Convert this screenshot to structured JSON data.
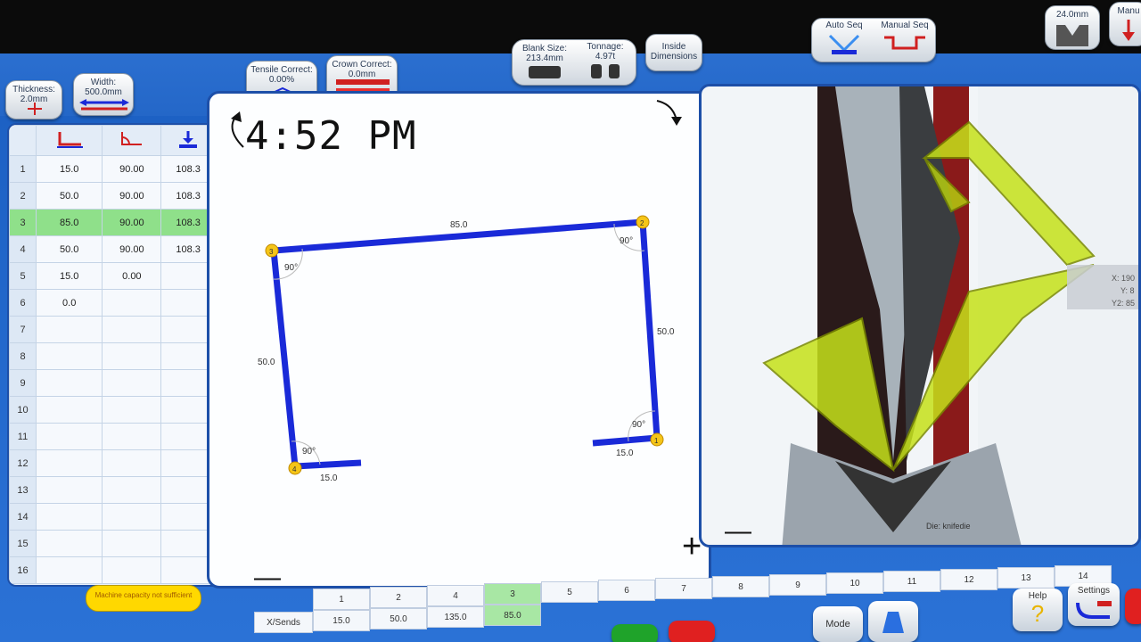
{
  "toolbar": {
    "thickness": {
      "label": "Thickness:",
      "value": "2.0mm"
    },
    "width": {
      "label": "Width:",
      "value": "500.0mm"
    },
    "tensile": {
      "label": "Tensile Correct:",
      "value": "0.00%"
    },
    "crown": {
      "label": "Crown Correct:",
      "value": "0.0mm"
    },
    "blank_size": {
      "label": "Blank Size:",
      "value": "213.4mm"
    },
    "tonnage": {
      "label": "Tonnage:",
      "value": "4.97t"
    },
    "inside_dimensions": {
      "label": "Inside Dimensions"
    },
    "auto_seq": {
      "label": "Auto Seq"
    },
    "manual_seq": {
      "label": "Manual Seq"
    },
    "tool_value": "24.0mm",
    "manual_label": "Manu"
  },
  "bend_table": {
    "rows": [
      {
        "num": "1",
        "length": "15.0",
        "angle": "90.00",
        "pos": "108.3",
        "more": "..."
      },
      {
        "num": "2",
        "length": "50.0",
        "angle": "90.00",
        "pos": "108.3",
        "more": "..."
      },
      {
        "num": "3",
        "length": "85.0",
        "angle": "90.00",
        "pos": "108.3",
        "more": "..."
      },
      {
        "num": "4",
        "length": "50.0",
        "angle": "90.00",
        "pos": "108.3",
        "more": "..."
      },
      {
        "num": "5",
        "length": "15.0",
        "angle": "0.00",
        "pos": "",
        "more": ""
      },
      {
        "num": "6",
        "length": "0.0",
        "angle": "",
        "pos": "",
        "more": ""
      },
      {
        "num": "7",
        "length": "",
        "angle": "",
        "pos": "",
        "more": ""
      },
      {
        "num": "8",
        "length": "",
        "angle": "",
        "pos": "",
        "more": ""
      },
      {
        "num": "9",
        "length": "",
        "angle": "",
        "pos": "",
        "more": ""
      },
      {
        "num": "10",
        "length": "",
        "angle": "",
        "pos": "",
        "more": ""
      },
      {
        "num": "11",
        "length": "",
        "angle": "",
        "pos": "",
        "more": ""
      },
      {
        "num": "12",
        "length": "",
        "angle": "",
        "pos": "",
        "more": ""
      },
      {
        "num": "13",
        "length": "",
        "angle": "",
        "pos": "",
        "more": ""
      },
      {
        "num": "14",
        "length": "",
        "angle": "",
        "pos": "",
        "more": ""
      },
      {
        "num": "15",
        "length": "",
        "angle": "",
        "pos": "",
        "more": ""
      },
      {
        "num": "16",
        "length": "",
        "angle": "",
        "pos": "",
        "more": ""
      }
    ],
    "selected_row": "3"
  },
  "drawing": {
    "time": "4:52 PM",
    "dim_top": "85.0",
    "dim_left": "50.0",
    "dim_right": "50.0",
    "dim_bottom_left": "15.0",
    "dim_bottom_right": "15.0",
    "angle_label": "90°",
    "node_labels": [
      "1",
      "2",
      "3",
      "4"
    ],
    "zoom_in": "+",
    "zoom_out": "—"
  },
  "view3d": {
    "die_label": "Die: knifedie",
    "coords": [
      "X: 190",
      "Y: 8",
      "Y2: 85"
    ],
    "zoom_out": "—"
  },
  "sequence": {
    "bend_numbers": [
      "1",
      "2",
      "4",
      "3",
      "5",
      "6",
      "7",
      "8",
      "9",
      "10",
      "11",
      "12",
      "13",
      "14"
    ],
    "row_label": "X/Sends",
    "values": [
      "15.0",
      "50.0",
      "135.0",
      "85.0"
    ],
    "selected_index": 3
  },
  "bottom": {
    "mode_label": "Mode",
    "help_label": "Help",
    "settings_label": "Settings",
    "warning_text": "Machine capacity not sufficient"
  },
  "colors": {
    "frame_blue": "#1d4fa8",
    "part_blue": "#1a2ad8",
    "node_yellow": "#f5c518",
    "selected_green": "#8fe08a",
    "part3d_yellow": "#c6e21a"
  }
}
